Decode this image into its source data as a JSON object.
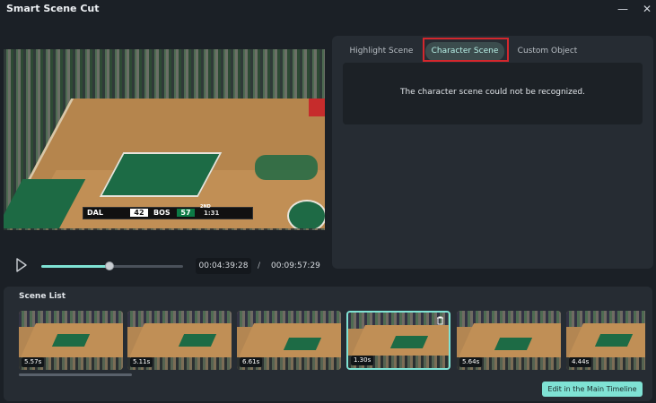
{
  "window": {
    "title": "Smart Scene Cut",
    "minimize_glyph": "—",
    "close_glyph": "✕"
  },
  "video": {
    "scorebug": {
      "team_a": "DAL",
      "team_a_score": "42",
      "team_b": "BOS",
      "team_b_score": "57",
      "quarter": "2ND",
      "clock": "1:31"
    }
  },
  "playback": {
    "progress": 0.48,
    "current_time": "00:04:39:28",
    "separator": "/",
    "total_time": "00:09:57:29"
  },
  "tabs": [
    {
      "label": "Highlight Scene"
    },
    {
      "label": "Character Scene"
    },
    {
      "label": "Custom Object"
    }
  ],
  "message": "The character scene could not be recognized.",
  "scene_list": {
    "title": "Scene List",
    "scenes": [
      {
        "duration": "5.57s"
      },
      {
        "duration": "5.11s"
      },
      {
        "duration": "6.61s"
      },
      {
        "duration": "1.30s"
      },
      {
        "duration": "5.64s"
      },
      {
        "duration": "4.44s"
      }
    ],
    "edit_button": "Edit in the Main Timeline"
  },
  "colors": {
    "accent": "#7fe2d4",
    "highlight_outline": "#d3272d",
    "panel": "#262c33",
    "background": "#1b2026"
  }
}
